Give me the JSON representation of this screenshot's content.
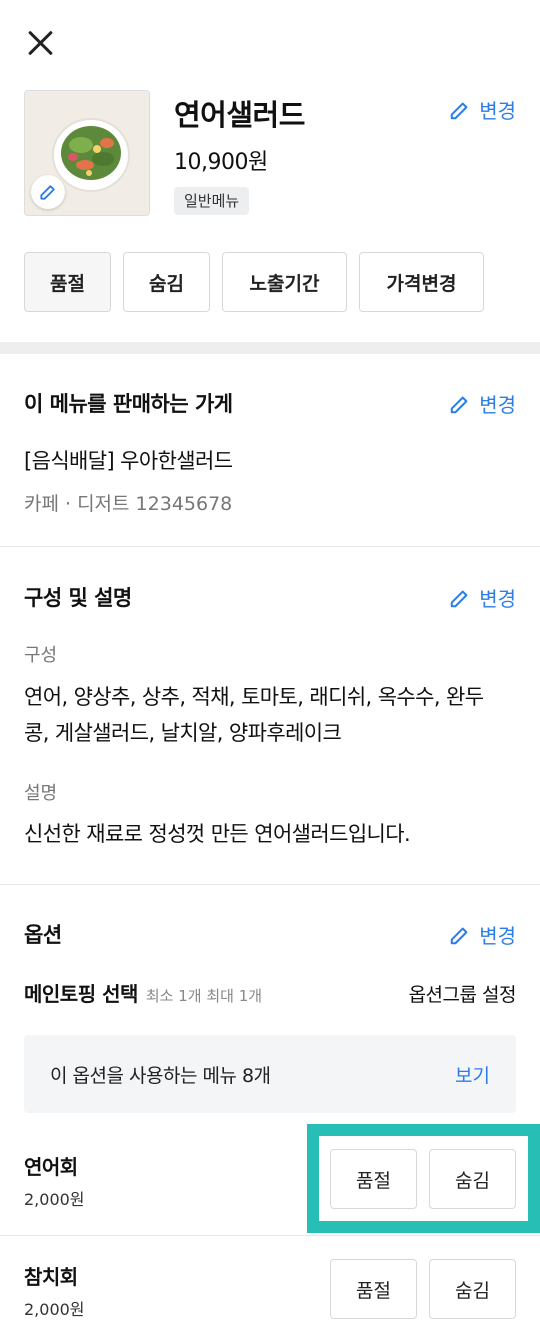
{
  "header": {
    "close_icon": "close-icon"
  },
  "menu": {
    "name": "연어샐러드",
    "price": "10,900원",
    "badge": "일반메뉴",
    "edit_label": "변경",
    "image_icon": "salad-photo",
    "buttons": [
      "품절",
      "숨김",
      "노출기간",
      "가격변경"
    ]
  },
  "store_section": {
    "title": "이 메뉴를 판매하는 가게",
    "edit_label": "변경",
    "store_name": "[음식배달] 우아한샐러드",
    "store_meta": "카페 · 디저트 12345678"
  },
  "desc_section": {
    "title": "구성 및 설명",
    "edit_label": "변경",
    "composition_label": "구성",
    "composition_line1": "연어, 양상추, 상추, 적채, 토마토, 래디쉬, 옥수수, 완두",
    "composition_line2": "콩, 게살샐러드, 날치알, 양파후레이크",
    "description_label": "설명",
    "description": "신선한 재료로 정성껏 만든 연어샐러드입니다."
  },
  "option_section": {
    "title": "옵션",
    "edit_label": "변경",
    "group_name": "메인토핑 선택",
    "group_limit": "최소 1개 최대 1개",
    "group_setting": "옵션그룹 설정",
    "info_text": "이 옵션을 사용하는 메뉴 8개",
    "info_view": "보기",
    "items": [
      {
        "name": "연어회",
        "price": "2,000원",
        "soldout_label": "품절",
        "hide_label": "숨김"
      },
      {
        "name": "참치회",
        "price": "2,000원",
        "soldout_label": "품절",
        "hide_label": "숨김"
      }
    ]
  },
  "colors": {
    "accent": "#2b7de9",
    "highlight": "#27beb5",
    "divider": "#eeeeee"
  }
}
